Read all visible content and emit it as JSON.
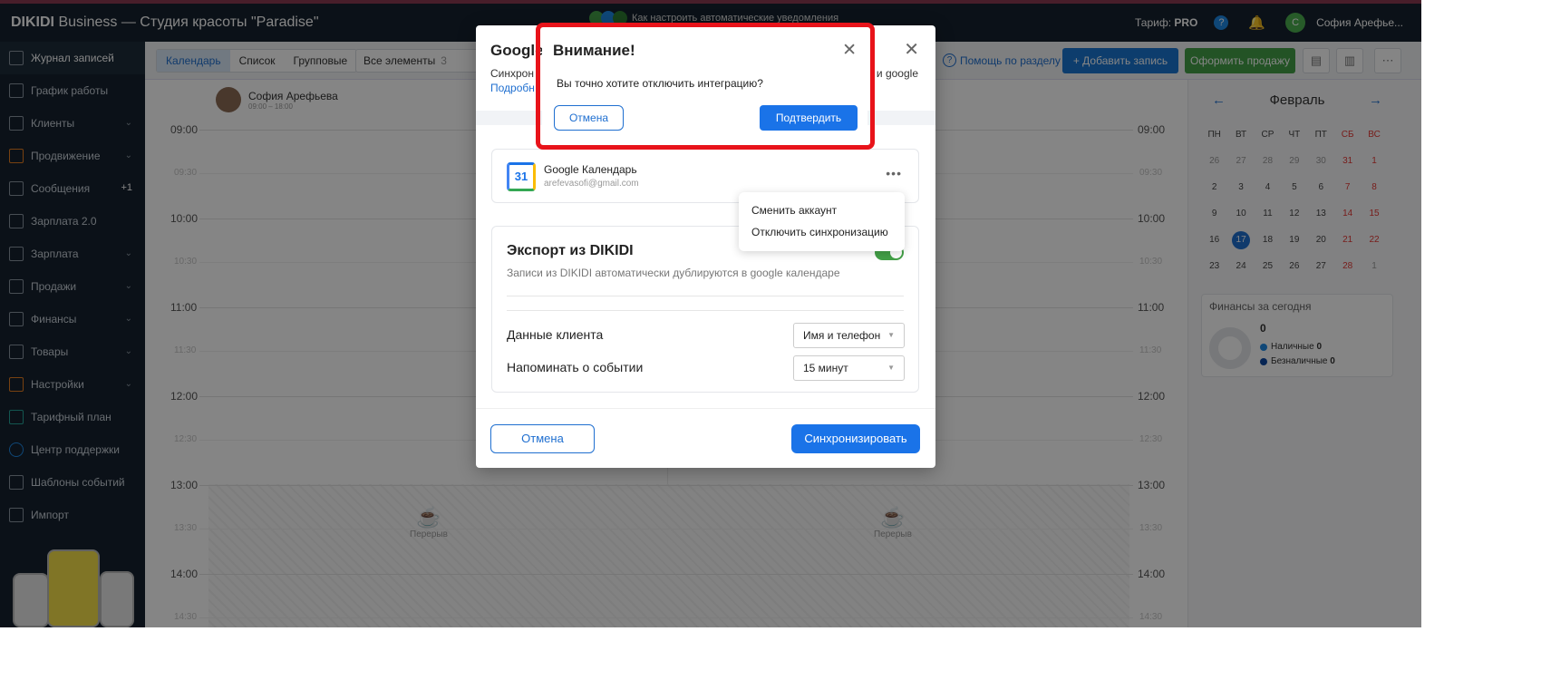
{
  "app": {
    "brand_bold": "DIKIDI",
    "brand_rest": " Business",
    "separator": "—",
    "studio": "Студия красоты \"Paradise\""
  },
  "top": {
    "notice": "Как настроить автоматические уведомления",
    "tariff_label": "Тариф:",
    "tariff_value": "PRO",
    "help": "?",
    "avatar_letter": "С",
    "user_name": "София Арефье..."
  },
  "sidebar": {
    "items": [
      {
        "label": "Журнал записей",
        "icon": "journal-icon"
      },
      {
        "label": "График работы",
        "icon": "schedule-icon"
      },
      {
        "label": "Клиенты",
        "icon": "clients-icon",
        "chevron": "⌄"
      },
      {
        "label": "Продвижение",
        "icon": "rocket-icon",
        "chevron": "⌄"
      },
      {
        "label": "Сообщения",
        "icon": "messages-icon",
        "badge": "+1"
      },
      {
        "label": "Зарплата 2.0",
        "icon": "salary-icon"
      },
      {
        "label": "Зарплата",
        "icon": "salary-icon",
        "chevron": "⌄"
      },
      {
        "label": "Продажи",
        "icon": "sales-icon",
        "chevron": "⌄"
      },
      {
        "label": "Финансы",
        "icon": "finance-icon",
        "chevron": "⌄"
      },
      {
        "label": "Товары",
        "icon": "goods-icon",
        "chevron": "⌄"
      },
      {
        "label": "Настройки",
        "icon": "settings-icon",
        "chevron": "⌄"
      },
      {
        "label": "Тарифный план",
        "icon": "layers-icon"
      },
      {
        "label": "Центр поддержки",
        "icon": "support-icon"
      },
      {
        "label": "Шаблоны событий",
        "icon": "templates-icon"
      },
      {
        "label": "Импорт",
        "icon": "import-icon"
      }
    ]
  },
  "toolbar": {
    "tabs": [
      "Календарь",
      "Список",
      "Групповые"
    ],
    "all_elements": "Все элементы",
    "all_count": "3",
    "help_section": "Помощь по разделу",
    "add_record": "+ Добавить запись",
    "sale": "Оформить продажу"
  },
  "staff": {
    "name": "София Арефьева",
    "hours": "09:00 – 18:00"
  },
  "times": {
    "full": [
      "09:00",
      "10:00",
      "11:00",
      "12:00",
      "13:00",
      "14:00"
    ],
    "half": [
      "09:30",
      "10:30",
      "11:30",
      "12:30",
      "13:30",
      "14:30"
    ]
  },
  "break_label": "Перерыв",
  "calendar": {
    "month": "Февраль",
    "prev": "←",
    "next": "→",
    "weekdays": [
      "ПН",
      "ВТ",
      "СР",
      "ЧТ",
      "ПТ",
      "СБ",
      "ВС"
    ],
    "weeks": [
      [
        "26",
        "27",
        "28",
        "29",
        "30",
        "31",
        "1"
      ],
      [
        "2",
        "3",
        "4",
        "5",
        "6",
        "7",
        "8"
      ],
      [
        "9",
        "10",
        "11",
        "12",
        "13",
        "14",
        "15"
      ],
      [
        "16",
        "17",
        "18",
        "19",
        "20",
        "21",
        "22"
      ],
      [
        "23",
        "24",
        "25",
        "26",
        "27",
        "28",
        "1"
      ]
    ],
    "current": "17"
  },
  "finance": {
    "title": "Финансы за сегодня",
    "total": "0",
    "cash_label": "Наличные",
    "cash": "0",
    "noncash_label": "Безналичные",
    "noncash": "0"
  },
  "modal": {
    "title": "Google",
    "close": "✕",
    "subtitle_start": "Синхрон",
    "subtitle_tail": "и google",
    "link": "Подробн",
    "account_name": "Google Календарь",
    "account_email": "arefevasofi@gmail.com",
    "gcal_day": "31",
    "export_title": "Экспорт из DIKIDI",
    "export_desc": "Записи из DIKIDI автоматически дублируются в google календаре",
    "client_data_label": "Данные клиента",
    "client_data_value": "Имя и телефон",
    "remind_label": "Напоминать о событии",
    "remind_value": "15 минут",
    "cancel": "Отмена",
    "sync": "Синхронизировать"
  },
  "menu": {
    "change_account": "Сменить аккаунт",
    "disable_sync": "Отключить синхронизацию"
  },
  "confirm": {
    "title": "Внимание!",
    "close": "✕",
    "question": "Вы точно хотите отключить интеграцию?",
    "cancel": "Отмена",
    "confirm": "Подтвердить"
  },
  "colors": {
    "accent": "#1a73e8",
    "sale": "#43a047",
    "dark": "#16222e",
    "highlight": "#e8131a"
  }
}
